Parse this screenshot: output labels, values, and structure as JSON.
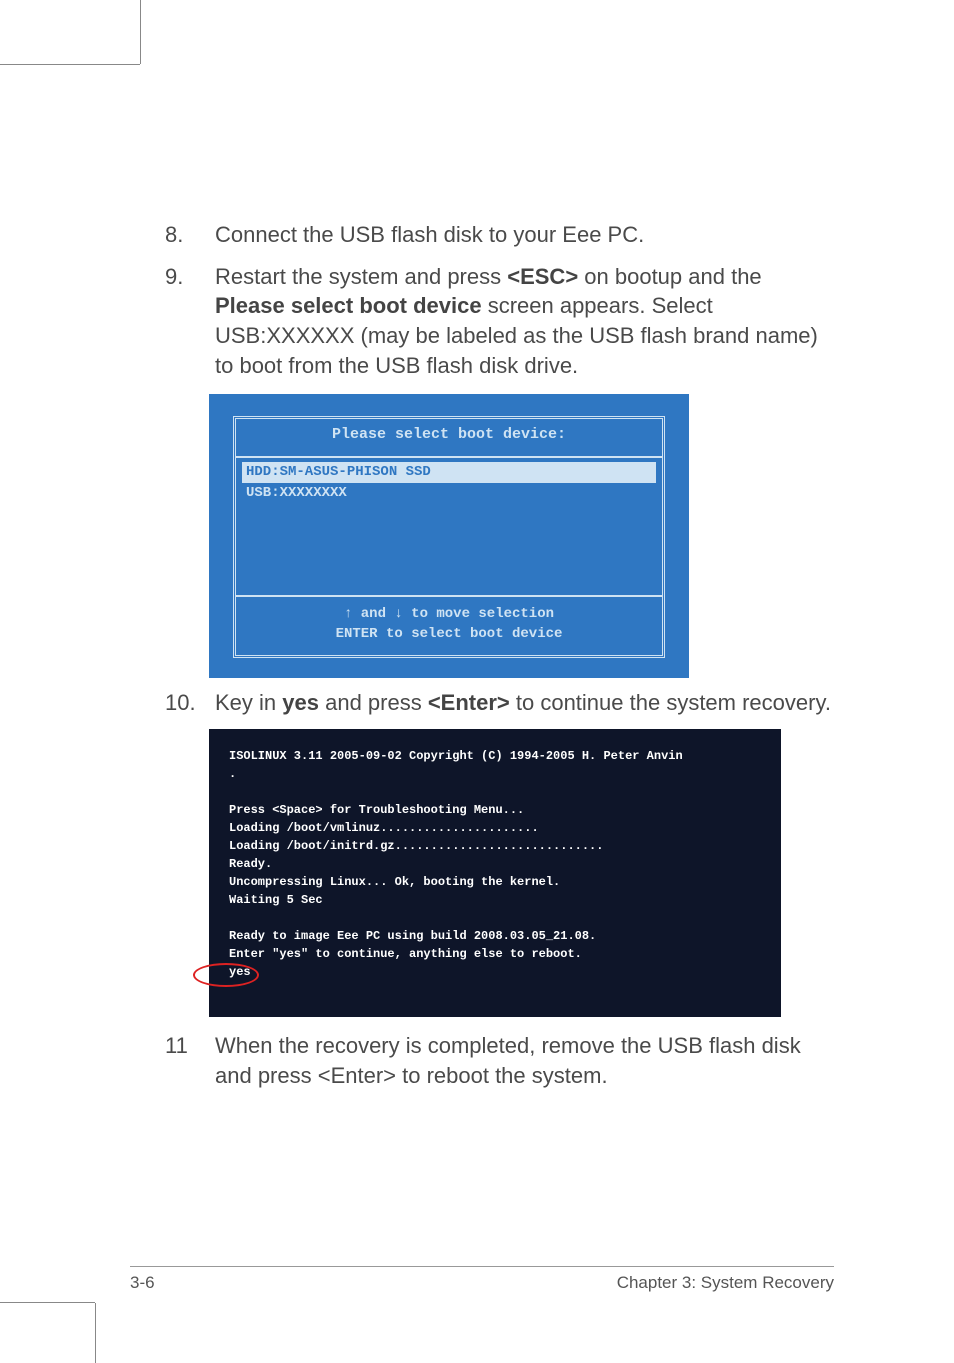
{
  "steps": {
    "8": {
      "num": "8.",
      "text": "Connect the USB flash disk to your Eee PC."
    },
    "9": {
      "num": "9.",
      "prefix": "Restart the system and press ",
      "esc": "<ESC>",
      "mid1": " on bootup and the ",
      "bold1": "Please select boot device",
      "tail": " screen appears. Select USB:XXXXXX (may be labeled as the USB flash brand name) to boot from the USB flash disk drive."
    },
    "10": {
      "num": "10.",
      "prefix": "Key in ",
      "yes": "yes",
      "mid": " and press ",
      "enter": "<Enter>",
      "tail": " to continue the system recovery."
    },
    "11": {
      "num": "11",
      "text": "When the recovery is completed, remove the USB flash disk and press <Enter> to reboot the system."
    }
  },
  "bios": {
    "title": "Please select boot device:",
    "row1": "HDD:SM-ASUS-PHISON SSD",
    "row2": "USB:XXXXXXXX",
    "help1": "↑ and ↓ to move selection",
    "help2": "ENTER to select boot device"
  },
  "terminal": {
    "l1": "ISOLINUX 3.11 2005-09-02 Copyright (C) 1994-2005 H. Peter Anvin",
    "l1b": ".",
    "l2": "",
    "l3": "Press <Space> for Troubleshooting Menu...",
    "l4": "Loading /boot/vmlinuz......................",
    "l5": "Loading /boot/initrd.gz.............................",
    "l6": "Ready.",
    "l7": "Uncompressing Linux... Ok, booting the kernel.",
    "l8": "Waiting 5 Sec",
    "l9": "",
    "l10": "Ready to image Eee PC using build 2008.03.05_21.08.",
    "l11": "Enter \"yes\" to continue, anything else to reboot.",
    "l12": "yes"
  },
  "footer": {
    "left": "3-6",
    "right": "Chapter 3: System Recovery"
  }
}
